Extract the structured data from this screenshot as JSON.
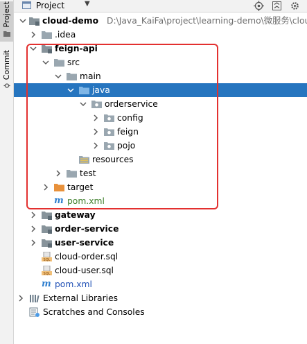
{
  "toolwindow": {
    "tabs": [
      {
        "label": "Project",
        "icon": "folder-icon"
      },
      {
        "label": "Commit",
        "icon": "commit-icon"
      }
    ],
    "title": "Project",
    "header_actions": [
      "target-icon",
      "collapse-all-icon",
      "settings-icon"
    ]
  },
  "tree": {
    "root": {
      "name": "cloud-demo",
      "path": "D:\\Java_KaiFa\\project\\learning-demo\\微服务\\clou"
    },
    "idea": ".idea",
    "feign_api": "feign-api",
    "src": "src",
    "main": "main",
    "java": "java",
    "orderservice": "orderservice",
    "config": "config",
    "feign": "feign",
    "pojo": "pojo",
    "resources": "resources",
    "test": "test",
    "target": "target",
    "pom_feign": "pom.xml",
    "gateway": "gateway",
    "order_service": "order-service",
    "user_service": "user-service",
    "cloud_order_sql": "cloud-order.sql",
    "cloud_user_sql": "cloud-user.sql",
    "pom_root": "pom.xml",
    "external_libraries": "External Libraries",
    "scratches": "Scratches and Consoles"
  },
  "colors": {
    "selection": "#2675bf",
    "highlight_box": "#e3302f",
    "target_folder": "#e8913b",
    "module_folder": "#87939a"
  }
}
